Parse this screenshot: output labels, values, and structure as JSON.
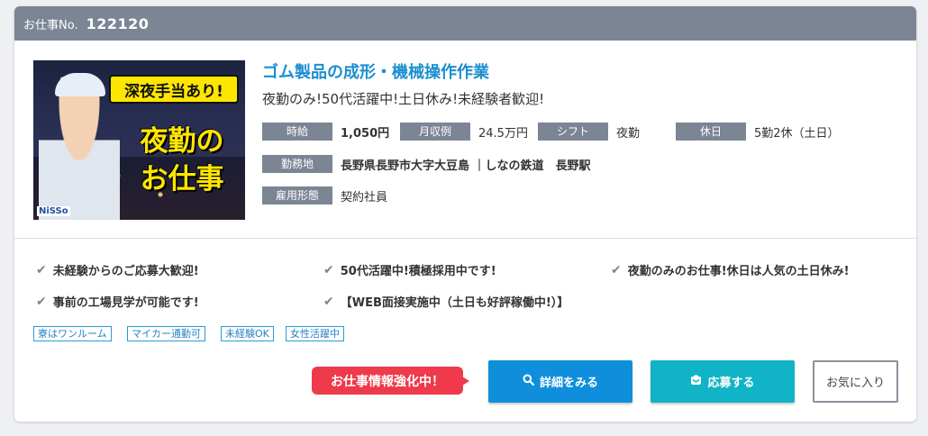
{
  "header": {
    "label": "お仕事No.",
    "number": "122120"
  },
  "thumbnail": {
    "banner": "深夜手当あり!",
    "line1": "夜勤の",
    "line2": "お仕事",
    "logo": "NiSSo"
  },
  "job": {
    "title": "ゴム製品の成形・機械操作作業",
    "catch": "夜勤のみ!50代活躍中!土日休み!未経験者歓迎!"
  },
  "info": {
    "hourly_label": "時給",
    "hourly_value": "1,050円",
    "monthly_label": "月収例",
    "monthly_value": "24.5万円",
    "shift_label": "シフト",
    "shift_value": "夜勤",
    "holiday_label": "休日",
    "holiday_value": "5勤2休（土日）",
    "location_label": "勤務地",
    "location_value": "長野県長野市大字大豆島 ｜しなの鉄道　長野駅",
    "employment_label": "雇用形態",
    "employment_value": "契約社員"
  },
  "features": [
    "未経験からのご応募大歓迎!",
    "50代活躍中!積極採用中です!",
    "夜勤のみのお仕事!休日は人気の土日休み!",
    "事前の工場見学が可能です!",
    "【WEB面接実施中（土日も好評稼働中!）】"
  ],
  "chips": [
    "寮はワンルーム",
    "マイカー通勤可",
    "未経験OK",
    "女性活躍中"
  ],
  "actions": {
    "promo": "お仕事情報強化中！",
    "detail": "詳細をみる",
    "apply": "応募する",
    "favorite": "お気に入り"
  },
  "icons": {
    "check": "check-icon",
    "search": "search-icon",
    "apply": "envelope-icon"
  },
  "colors": {
    "header": "#7b8594",
    "title": "#1c8fd0",
    "detail_btn": "#0f8fdb",
    "apply_btn": "#11b3c6",
    "promo": "#ee3a4a"
  }
}
